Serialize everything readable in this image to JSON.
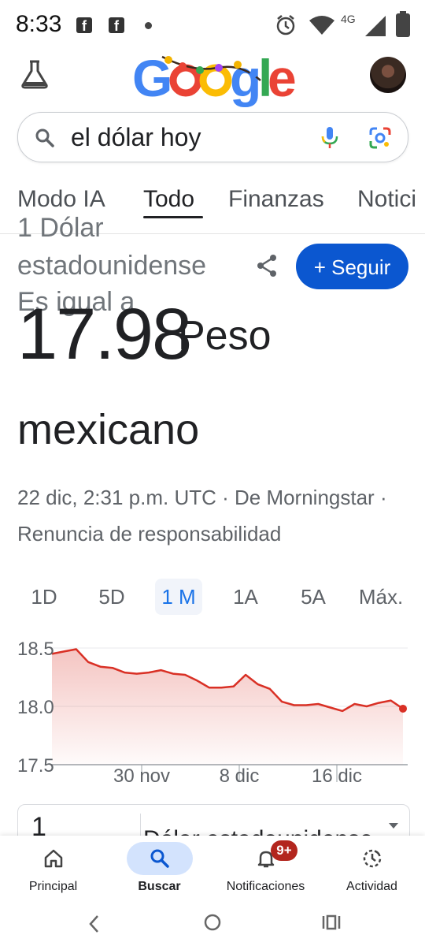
{
  "status_bar": {
    "time": "8:33",
    "network": "4G"
  },
  "search": {
    "query": "el dólar hoy"
  },
  "tabs": [
    {
      "label": "Modo IA",
      "active": false
    },
    {
      "label": "Todo",
      "active": true
    },
    {
      "label": "Finanzas",
      "active": false
    },
    {
      "label": "Notici",
      "active": false
    }
  ],
  "currency": {
    "from_line1": "1 Dólar",
    "from_line2": "estadounidense",
    "equals": "Es igual a",
    "value": "17.98",
    "unit_line1": "Peso",
    "unit_line2": "mexicano",
    "follow_label": "+ Seguir",
    "meta_line1": "22 dic, 2:31 p.m. UTC · De Morningstar ·",
    "meta_line2": "Renuncia de responsabilidad"
  },
  "ranges": [
    {
      "label": "1D",
      "active": false
    },
    {
      "label": "5D",
      "active": false
    },
    {
      "label": "1 M",
      "active": true
    },
    {
      "label": "1A",
      "active": false
    },
    {
      "label": "5A",
      "active": false
    },
    {
      "label": "Máx.",
      "active": false
    }
  ],
  "chart_data": {
    "type": "area",
    "y_ticks": [
      "18.5",
      "18.0",
      "17.5"
    ],
    "ylim": [
      17.5,
      18.5
    ],
    "x_tick_labels": [
      "30 nov",
      "8 dic",
      "16 dic"
    ],
    "values": [
      18.45,
      18.47,
      18.49,
      18.38,
      18.34,
      18.33,
      18.29,
      18.28,
      18.29,
      18.31,
      18.28,
      18.27,
      18.22,
      18.16,
      18.16,
      18.17,
      18.27,
      18.19,
      18.15,
      18.04,
      18.01,
      18.01,
      18.02,
      17.99,
      17.96,
      18.02,
      18.0,
      18.03,
      18.05,
      17.98
    ],
    "color": "#d93025"
  },
  "converter": {
    "amount": "1",
    "currency": "Dólar estadounidense"
  },
  "bottom_nav": [
    {
      "label": "Principal",
      "icon": "home-icon"
    },
    {
      "label": "Buscar",
      "icon": "search-icon"
    },
    {
      "label": "Notificaciones",
      "icon": "bell-icon",
      "badge": "9+"
    },
    {
      "label": "Actividad",
      "icon": "activity-icon"
    }
  ]
}
